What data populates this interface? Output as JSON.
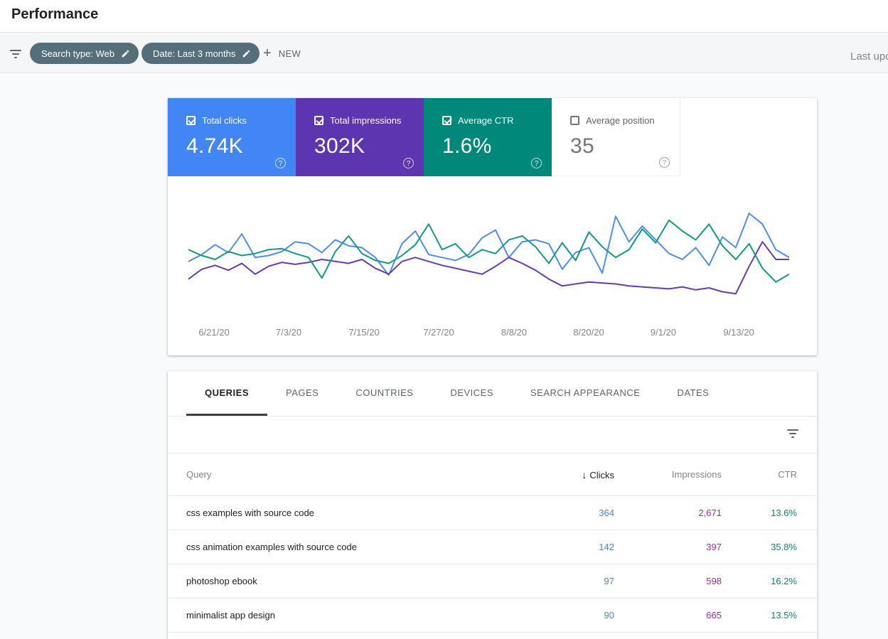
{
  "page": {
    "title": "Performance",
    "last_updated_text": "Last upd"
  },
  "filter_bar": {
    "chips": [
      {
        "label": "Search type: Web"
      },
      {
        "label": "Date: Last 3 months"
      }
    ],
    "new_button_label": "NEW"
  },
  "cards": [
    {
      "label": "Total clicks",
      "value": "4.74K",
      "checked": true,
      "color": "#4285f4",
      "text_color": "#ffffff",
      "help_icon": "?"
    },
    {
      "label": "Total impressions",
      "value": "302K",
      "checked": true,
      "color": "#5e35b1",
      "text_color": "#ffffff",
      "help_icon": "?"
    },
    {
      "label": "Average CTR",
      "value": "1.6%",
      "checked": true,
      "color": "#00897b",
      "text_color": "#ffffff",
      "help_icon": "?"
    },
    {
      "label": "Average position",
      "value": "35",
      "checked": false,
      "color": "#ffffff",
      "text_color": "#757575",
      "label_color": "#5f6368",
      "help_icon": "?"
    }
  ],
  "chart_data": {
    "type": "line",
    "title": "",
    "xlabel": "",
    "ylabel": "",
    "grid": false,
    "legend_position": "none",
    "ylim": [
      0,
      100
    ],
    "x_labels": [
      "6/21/20",
      "7/3/20",
      "7/15/20",
      "7/27/20",
      "8/8/20",
      "8/20/20",
      "9/1/20",
      "9/13/20"
    ],
    "series": [
      {
        "name": "Total clicks",
        "color": "#4e8df5",
        "values": [
          48,
          55,
          65,
          57,
          76,
          52,
          54,
          58,
          68,
          66,
          57,
          70,
          64,
          62,
          52,
          34,
          66,
          79,
          55,
          52,
          49,
          55,
          72,
          80,
          52,
          68,
          70,
          66,
          40,
          57,
          62,
          36,
          94,
          68,
          84,
          70,
          56,
          50,
          62,
          44,
          73,
          62,
          97,
          86,
          60,
          52
        ]
      },
      {
        "name": "Total impressions",
        "color": "#673ab7",
        "values": [
          30,
          40,
          44,
          39,
          46,
          35,
          43,
          47,
          45,
          47,
          50,
          48,
          46,
          50,
          41,
          35,
          48,
          52,
          48,
          44,
          41,
          38,
          35,
          43,
          52,
          46,
          39,
          30,
          23,
          25,
          27,
          26,
          25,
          23,
          22,
          21,
          20,
          22,
          19,
          21,
          17,
          15,
          43,
          68,
          50,
          50
        ]
      },
      {
        "name": "Average CTR",
        "color": "#0f9d82",
        "values": [
          60,
          54,
          50,
          58,
          54,
          56,
          60,
          61,
          56,
          52,
          31,
          58,
          74,
          56,
          49,
          46,
          54,
          65,
          86,
          60,
          66,
          52,
          60,
          56,
          70,
          74,
          63,
          46,
          67,
          49,
          78,
          63,
          52,
          60,
          81,
          67,
          90,
          79,
          70,
          86,
          64,
          50,
          66,
          41,
          27,
          35
        ]
      }
    ]
  },
  "table": {
    "tabs": [
      {
        "label": "QUERIES",
        "active": true
      },
      {
        "label": "PAGES",
        "active": false
      },
      {
        "label": "COUNTRIES",
        "active": false
      },
      {
        "label": "DEVICES",
        "active": false
      },
      {
        "label": "SEARCH APPEARANCE",
        "active": false
      },
      {
        "label": "DATES",
        "active": false
      }
    ],
    "columns": {
      "query": "Query",
      "clicks": "Clicks",
      "impressions": "Impressions",
      "ctr": "CTR"
    },
    "sort": {
      "column": "Clicks",
      "direction": "desc",
      "icon": "↓"
    },
    "value_colors": {
      "clicks": "#4285f4",
      "impressions": "#9c27b0",
      "ctr": "#00897b"
    },
    "rows": [
      {
        "query": "css examples with source code",
        "clicks": "364",
        "impressions": "2,671",
        "ctr": "13.6%"
      },
      {
        "query": "css animation examples with source code",
        "clicks": "142",
        "impressions": "397",
        "ctr": "35.8%"
      },
      {
        "query": "photoshop ebook",
        "clicks": "97",
        "impressions": "598",
        "ctr": "16.2%"
      },
      {
        "query": "minimalist app design",
        "clicks": "90",
        "impressions": "665",
        "ctr": "13.5%"
      }
    ]
  }
}
